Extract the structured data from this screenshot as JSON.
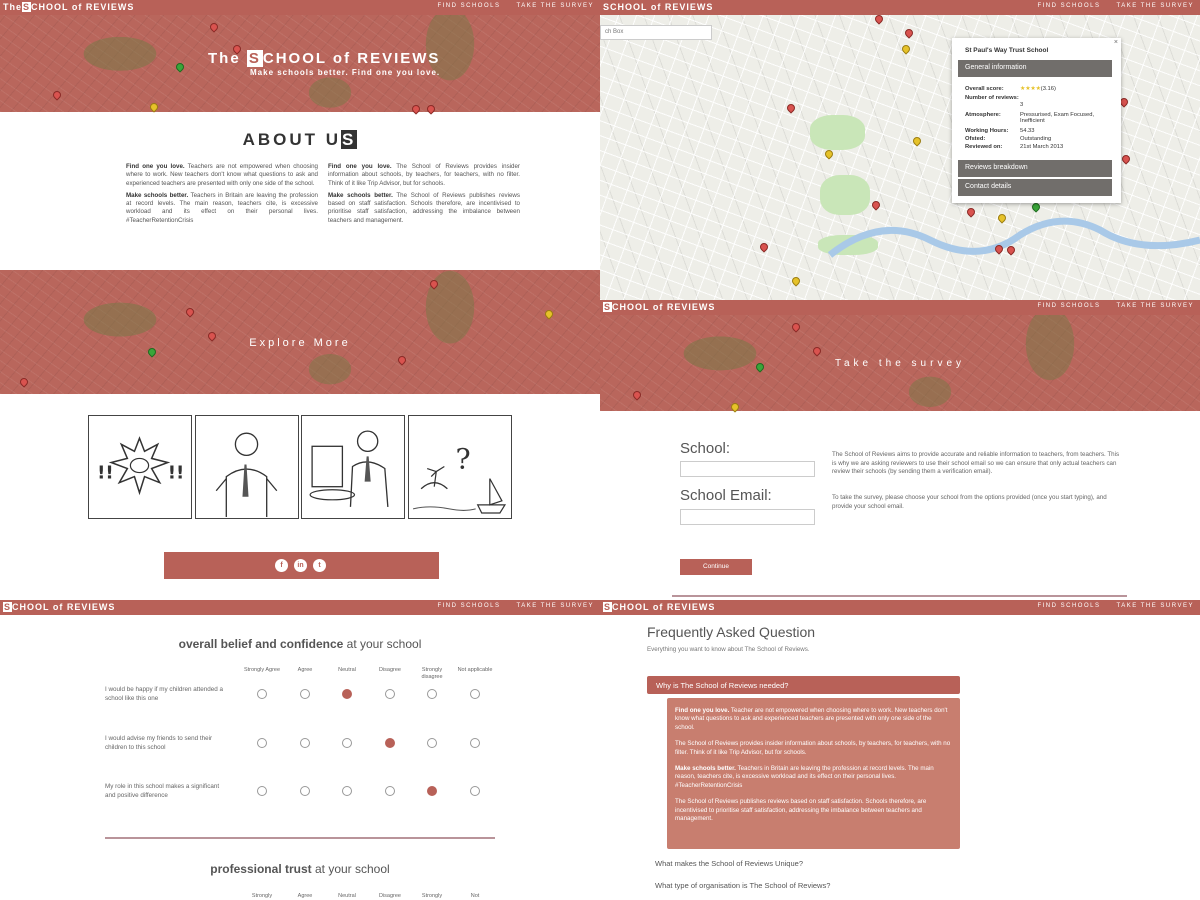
{
  "header": {
    "brand_prefix": "The",
    "brand_box": "S",
    "brand_rest": "CHOOL of REVIEWS",
    "brand_prefix_alt": "",
    "nav_find": "FIND SCHOOLS",
    "nav_survey": "TAKE THE SURVEY"
  },
  "about": {
    "hero_prefix": "The ",
    "hero_box": "S",
    "hero_rest": "CHOOL of REVIEWS",
    "hero_tagline": "Make schools better. Find one you love.",
    "heading_main": "ABOUT U",
    "heading_box": "S",
    "col1_p1_bold": "Find one you love.",
    "col1_p1": " Teachers are not empowered when choosing where to work. New teachers don't know what questions to ask and experienced teachers are presented with only one side of the school.",
    "col1_p2_bold": "Make schools better.",
    "col1_p2": " Teachers in Britain are leaving the profession at record levels. The main reason, teachers cite, is excessive workload and its effect on their personal lives. #TeacherRetentionCrisis",
    "col2_p1_bold": "Find one you love.",
    "col2_p1": " The School of Reviews provides insider information about schools, by teachers, for teachers, with no filter. Think of it like Trip Advisor, but for schools.",
    "col2_p2_bold": "Make schools better.",
    "col2_p2": " The School of Reviews publishes reviews based on staff satisfaction. Schools therefore, are incentivised to prioritise staff satisfaction, addressing the imbalance between teachers and management.",
    "explore": "Explore More",
    "social": [
      "f",
      "in",
      "t"
    ]
  },
  "map": {
    "search_placeholder": "ch Box",
    "info": {
      "school": "St Paul's Way Trust School",
      "general_tab": "General information",
      "overall_label": "Overall score:",
      "overall_stars": "★★★★",
      "overall_value": "(3.16)",
      "reviews_label": "Number of reviews:",
      "reviews_value": "3",
      "atmosphere_label": "Atmosphere:",
      "atmosphere_value": "Pressurised, Exam Focused, Inefficient",
      "hours_label": "Working Hours:",
      "hours_value": "54.33",
      "ofsted_label": "Ofsted:",
      "ofsted_value": "Outstanding",
      "reviewed_label": "Reviewed on:",
      "reviewed_value": "21st March 2013",
      "breakdown_tab": "Reviews breakdown",
      "contact_tab": "Contact details",
      "close": "×"
    }
  },
  "survey": {
    "hero_title": "Take the survey",
    "school_label": "School:",
    "email_label": "School Email:",
    "text_p1": "The School of Reviews aims to provide accurate and reliable information to teachers, from teachers. This is why we are asking reviewers to use their school email so we can ensure that only actual teachers can review their schools (by sending them a verification email).",
    "text_p2": "To take the survey, please choose your school from the options provided (once you start typing), and provide your school email.",
    "continue": "Continue"
  },
  "questionnaire": {
    "section1_bold": "overall belief and confidence",
    "section1_rest": " at your school",
    "options": [
      "Strongly Agree",
      "Agree",
      "Neutral",
      "Disagree",
      "Strongly disagree",
      "Not applicable"
    ],
    "questions": [
      {
        "text": "I would be happy if my children attended a school like this one",
        "selected": 2
      },
      {
        "text": "I would advise my friends to send their children to this school",
        "selected": 3
      },
      {
        "text": "My role in this school makes a significant and positive difference",
        "selected": 4
      }
    ],
    "section2_bold": "professional trust",
    "section2_rest": " at your school",
    "options2": [
      "Strongly",
      "Agree",
      "Neutral",
      "Disagree",
      "Strongly",
      "Not"
    ]
  },
  "faq": {
    "title": "Frequently Asked Question",
    "subtitle": "Everything you want to know about The School of Reviews.",
    "q1": "Why is The School of Reviews needed?",
    "a_p1_bold": "Find one you love.",
    "a_p1": " Teacher are not empowered when choosing where to work. New teachers don't know what questions to ask and experienced teachers are presented with only one side of the school.",
    "a_p2": "The School of Reviews provides insider information about schools, by teachers, for teachers, with no filter. Think of it like Trip Advisor, but for schools.",
    "a_p3_bold": "Make schools better.",
    "a_p3": " Teachers in Britain are leaving the profession at record levels. The main reason, teachers cite, is excessive workload and its effect on their personal lives. #TeacherRetentionCrisis",
    "a_p4": "The School of Reviews publishes reviews based on staff satisfaction. Schools therefore, are incentivised to prioritise staff satisfaction, addressing the imbalance between teachers and management.",
    "q2": "What makes the School of Reviews Unique?",
    "q3": "What type of organisation is The School of Reviews?"
  },
  "colors": {
    "brand": "#b86158",
    "answer_bg": "#c87e6f",
    "info_tab": "#716e6b"
  }
}
